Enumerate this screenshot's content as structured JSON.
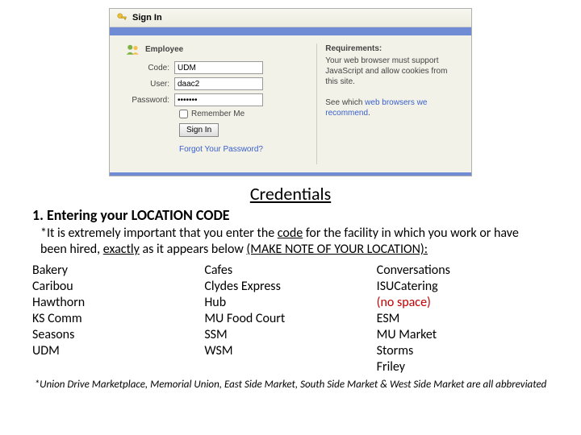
{
  "signin": {
    "title": "Sign In",
    "employee": "Employee",
    "labels": {
      "code": "Code:",
      "user": "User:",
      "password": "Password:"
    },
    "values": {
      "code": "UDM",
      "user": "daac2",
      "password": "•••••••"
    },
    "remember": "Remember Me",
    "button": "Sign In",
    "forgot": "Forgot Your Password?",
    "req_head": "Requirements:",
    "req_body1": "Your web browser must support JavaScript and allow cookies from this site.",
    "req_body2a": "See which ",
    "req_link": "web browsers we recommend",
    "req_body2b": "."
  },
  "heading": "Credentials",
  "step": "1.  Entering your LOCATION CODE",
  "note_before": "*It is extremely important that you enter the ",
  "note_code": "code",
  "note_mid": " for the facility in which you work or have been hired, ",
  "note_exactly": "exactly",
  "note_after": " as it appears below ",
  "note_make": "(MAKE NOTE OF YOUR LOCATION):",
  "codes": {
    "col1": [
      "Bakery",
      "Caribou",
      "Hawthorn",
      "KS Comm",
      "Seasons",
      "UDM"
    ],
    "col2": [
      "Cafes",
      "Clydes Express",
      "Hub",
      "MU Food Court",
      "SSM",
      "WSM"
    ],
    "col3": [
      "Conversations",
      "ISUCatering",
      "ESM",
      "MU Market",
      "Storms",
      "Friley"
    ],
    "nospace": " (no space)"
  },
  "footnote": "*Union Drive Marketplace, Memorial Union, East Side Market, South Side Market & West Side Market are all abbreviated"
}
